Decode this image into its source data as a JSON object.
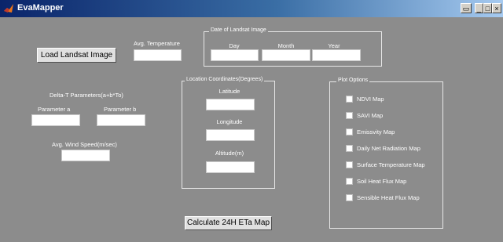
{
  "window": {
    "title": "EvaMapper"
  },
  "left": {
    "load_button": "Load Landsat Image",
    "avg_temperature_label": "Avg. Temperature",
    "avg_temperature_value": "",
    "delta_t_label": "Delta-T Parameters(a+b*To)",
    "param_a_label": "Parameter a",
    "param_a_value": "",
    "param_b_label": "Parameter b",
    "param_b_value": "",
    "wind_speed_label": "Avg. Wind Speed(m/sec)",
    "wind_speed_value": ""
  },
  "date": {
    "title": "Date of Landsat Image",
    "day_label": "Day",
    "month_label": "Month",
    "year_label": "Year",
    "day_value": "",
    "month_value": "",
    "year_value": ""
  },
  "location": {
    "title": "Location Coordinates(Degrees)",
    "latitude_label": "Latitude",
    "latitude_value": "",
    "longitude_label": "Longitude",
    "longitude_value": "",
    "altitude_label": "Altitude(m)",
    "altitude_value": ""
  },
  "plot_options": {
    "title": "Plot Options",
    "items": [
      "NDVI Map",
      "SAVI Map",
      "Emissvity Map",
      "Daily Net Radiation Map",
      "Surface Temperature Map",
      "Soil Heat Flux Map",
      "Sensible Heat Flux Map"
    ]
  },
  "calculate_button": "Calculate 24H ETa Map"
}
